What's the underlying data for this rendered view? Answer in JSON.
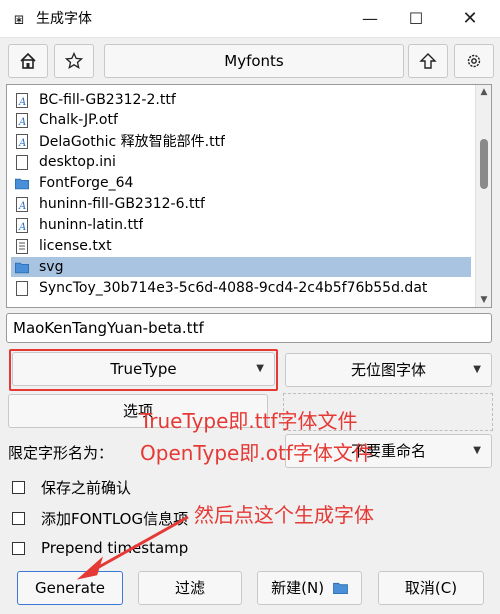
{
  "window": {
    "title": "生成字体",
    "minimize": "—",
    "maximize": "☐",
    "close": "✕"
  },
  "toolbar": {
    "home_icon": "home-icon",
    "bookmark_icon": "star-icon",
    "path": "Myfonts",
    "up_icon": "up-arrow-icon",
    "settings_icon": "gear-icon"
  },
  "files": [
    {
      "name": "BC-fill-GB2312-2.ttf",
      "type": "font"
    },
    {
      "name": "Chalk-JP.otf",
      "type": "font"
    },
    {
      "name": "DelaGothic 释放智能部件.ttf",
      "type": "font"
    },
    {
      "name": "desktop.ini",
      "type": "file"
    },
    {
      "name": "FontForge_64",
      "type": "folder"
    },
    {
      "name": "huninn-fill-GB2312-6.ttf",
      "type": "font"
    },
    {
      "name": "huninn-latin.ttf",
      "type": "font"
    },
    {
      "name": "license.txt",
      "type": "text"
    },
    {
      "name": "svg",
      "type": "folder",
      "selected": true
    },
    {
      "name": "SyncToy_30b714e3-5c6d-4088-9cd4-2c4b5f76b55d.dat",
      "type": "file"
    }
  ],
  "filename": "MaoKenTangYuan-beta.ttf",
  "format_select": "TrueType",
  "bitmap_select": "无位图字体",
  "options_button": "选项",
  "naming_label": "限定字形名为：",
  "naming_select": "不要重命名",
  "checkboxes": [
    {
      "label": "保存之前确认"
    },
    {
      "label": "添加FONTLOG信息项"
    },
    {
      "label": "Prepend timestamp"
    }
  ],
  "buttons": {
    "generate": "Generate",
    "filter": "过滤",
    "new": "新建(N)",
    "cancel": "取消(C)"
  },
  "annotations": {
    "line1": "TrueType即.ttf字体文件",
    "line2": "OpenType即.otf字体文件",
    "line3": "然后点这个生成字体"
  },
  "colors": {
    "annotation_red": "#e53935",
    "selection_blue": "#a9c4e0",
    "folder_blue": "#4a90d9"
  }
}
